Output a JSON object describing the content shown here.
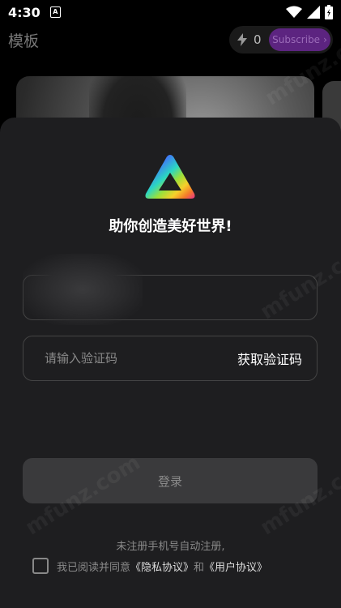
{
  "status_bar": {
    "time": "4:30",
    "notification_icon_letter": "A",
    "icons": [
      "notification-icon",
      "wifi-icon",
      "signal-icon",
      "battery-icon"
    ]
  },
  "background_app": {
    "title": "模板",
    "credits": "0",
    "subscribe_label": "Subscribe",
    "subscribe_color": "#5c2480"
  },
  "login_sheet": {
    "logo_icon": "prism-triangle-logo",
    "slogan": "助你创造美好世界!",
    "phone_placeholder": "",
    "code_placeholder": "请输入验证码",
    "get_code_label": "获取验证码",
    "login_label": "登录",
    "hint_text": "未注册手机号自动注册,",
    "agree_prefix": "我已阅读并同意",
    "privacy_link": "《隐私协议》",
    "agree_and": "和",
    "user_link": "《用户协议》"
  },
  "watermarks": [
    "mfunz.com",
    "mfunz.com",
    "mfunz.com",
    "mfunz.com"
  ]
}
